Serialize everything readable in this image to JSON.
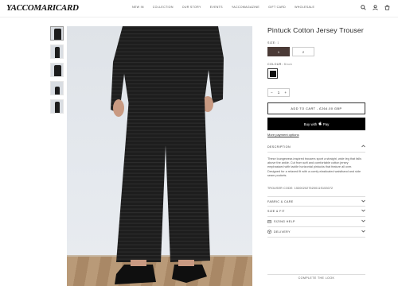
{
  "header": {
    "logo": "YACCOMARICARD",
    "nav": [
      "NEW IN",
      "COLLECTION",
      "OUR STORY",
      "EVENTS",
      "YACCOMAGAZINE",
      "GIFT CARD",
      "WHOLESALE"
    ],
    "icons": [
      "search-icon",
      "account-icon",
      "cart-icon"
    ]
  },
  "product": {
    "title": "Pintuck Cotton Jersey Trouser",
    "size_label": "SIZE",
    "size_value": "1",
    "sizes": [
      "1",
      "2"
    ],
    "selected_size": "1",
    "colour_label": "COLOUR",
    "colour_value": "Black",
    "swatch_color": "#111111",
    "qty_minus": "−",
    "qty_value": "1",
    "qty_plus": "+",
    "add_to_cart": "ADD TO CART - £264.00 GBP",
    "buy_with": "Buy with",
    "pay_brand": "Pay",
    "more_payment": "More payment options"
  },
  "accordion": {
    "description_label": "DESCRIPTION",
    "description_text": "These loungewear-inspired trousers sport a straight, wide leg that falls above the ankle. Cut from soft and comfortable cotton jersey emphasised with tactile horizontal pintucks that feature all over. Designed for a relaxed fit with a comfy elasticated waistband and side seam pockets.",
    "code": "TROUSER CODE: 153002027520011S153072",
    "fabric_label": "FABRIC & CARE",
    "size_fit_label": "SIZE & FIT",
    "sizing_help_label": "SIZING HELP",
    "delivery_label": "DELIVERY"
  },
  "complete_the_look": "COMPLETE THE LOOK",
  "colors": {
    "accent": "#4a3a36",
    "garment": "#1c1c1c",
    "backdrop": "#e2e6eb",
    "floor": "#b08f6d"
  }
}
